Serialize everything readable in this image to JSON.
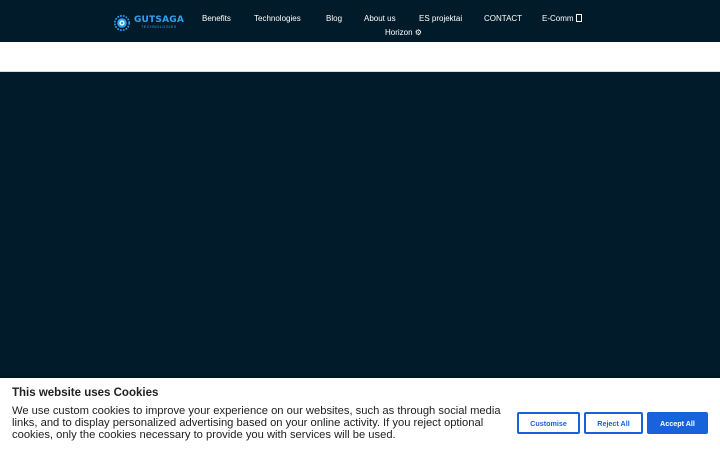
{
  "brand": {
    "name": "GUTSAGA",
    "subtitle": "TECHNOLOGIES",
    "accent_color": "#2ea3f2",
    "background_color": "#021b2b"
  },
  "nav": {
    "items": [
      {
        "label": "Benefits"
      },
      {
        "label": "Technologies"
      },
      {
        "label": "Blog"
      },
      {
        "label": "About us"
      },
      {
        "label": "ES projektai"
      },
      {
        "label": "CONTACT"
      },
      {
        "label": "E-Comm"
      },
      {
        "label": "Horizon ⚙"
      }
    ],
    "dropdown_icon": "square-glyph-icon"
  },
  "cookie_banner": {
    "title": "This website uses Cookies",
    "text": "We use custom cookies to improve your experience on our websites, such as through social media links, and to display personalized advertising based on your online activity. If you reject optional cookies, only the cookies necessary to provide you with services will be used.",
    "buttons": {
      "customise": "Customise",
      "reject": "Reject All",
      "accept": "Accept All"
    },
    "button_color": "#1863dc"
  }
}
